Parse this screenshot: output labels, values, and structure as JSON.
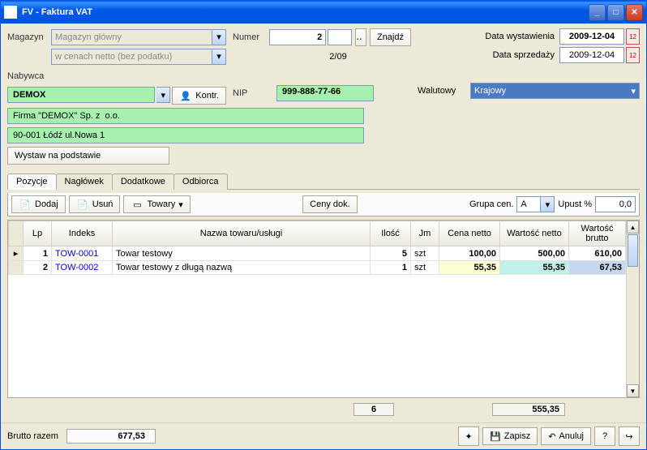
{
  "window": {
    "title": "FV - Faktura VAT"
  },
  "labels": {
    "magazyn": "Magazyn",
    "nabywca": "Nabywca",
    "kontr": "Kontr.",
    "numer": "Numer",
    "nip": "NIP",
    "znajdz": "Znajdź",
    "data_wystawienia": "Data wystawienia",
    "data_sprzedazy": "Data sprzedaży",
    "walutowy": "Walutowy",
    "wystaw": "Wystaw na podstawie",
    "dodaj": "Dodaj",
    "usun": "Usuń",
    "towary": "Towary",
    "ceny_dok": "Ceny dok.",
    "grupa_cen": "Grupa cen.",
    "upust": "Upust %",
    "brutto_razem": "Brutto razem",
    "zapisz": "Zapisz",
    "anuluj": "Anuluj"
  },
  "header": {
    "magazyn": "Magazyn główny",
    "ceny_mode": "w cenach netto (bez podatku)",
    "numer": "2",
    "numer_full": "2/09",
    "data_wystawienia": "2009-12-04",
    "data_sprzedazy": "2009-12-04",
    "walutowy": "Krajowy"
  },
  "buyer": {
    "short": "DEMOX",
    "name": "Firma \"DEMOX\" Sp. z  o.o.",
    "address": "90-001 Łódź ul.Nowa 1",
    "nip": "999-888-77-66"
  },
  "tabs": [
    "Pozycje",
    "Nagłówek",
    "Dodatkowe",
    "Odbiorca"
  ],
  "active_tab": 0,
  "toolbar2": {
    "grupa_cen": "A",
    "upust": "0,0"
  },
  "columns": [
    "Lp",
    "Indeks",
    "Nazwa towaru/usługi",
    "Ilość",
    "Jm",
    "Cena netto",
    "Wartość netto",
    "Wartość brutto"
  ],
  "rows": [
    {
      "lp": "1",
      "indeks": "TOW-0001",
      "nazwa": "Towar testowy",
      "ilosc": "5",
      "jm": "szt",
      "cena": "100,00",
      "netto": "500,00",
      "brutto": "610,00"
    },
    {
      "lp": "2",
      "indeks": "TOW-0002",
      "nazwa": "Towar testowy z długą nazwą",
      "ilosc": "1",
      "jm": "szt",
      "cena": "55,35",
      "netto": "55,35",
      "brutto": "67,53"
    }
  ],
  "sums": {
    "ilosc": "6",
    "netto": "555,35"
  },
  "footer": {
    "brutto_razem": "677,53"
  }
}
